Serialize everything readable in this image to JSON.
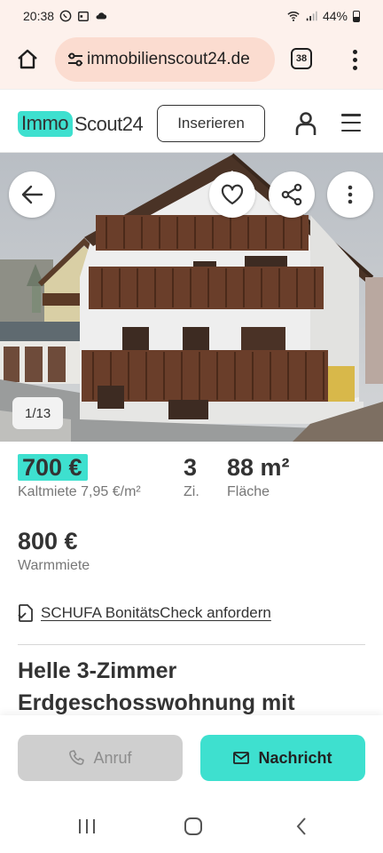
{
  "status_bar": {
    "time": "20:38",
    "battery": "44%"
  },
  "browser": {
    "url": "immobilienscout24.de",
    "tab_count": "38"
  },
  "site_header": {
    "logo_part1": "Immo",
    "logo_part2": "Scout24",
    "insert_label": "Inserieren"
  },
  "gallery": {
    "counter": "1/13"
  },
  "facts": {
    "rent": {
      "value": "700 €",
      "label": "Kaltmiete 7,95 €/m²"
    },
    "rooms": {
      "value": "3",
      "label": "Zi."
    },
    "area": {
      "value": "88 m²",
      "label": "Fläche"
    },
    "warm": {
      "value": "800 €",
      "label": "Warmmiete"
    }
  },
  "schufa_link": "SCHUFA BonitätsCheck anfordern",
  "listing_title": "Helle 3-Zimmer Erdgeschosswohnung mit",
  "actions": {
    "call_label": "Anruf",
    "message_label": "Nachricht"
  },
  "colors": {
    "accent": "#3ee0cf",
    "browser_bg": "#fdf1ec",
    "url_pill": "#fbdcd0",
    "text": "#333333"
  }
}
